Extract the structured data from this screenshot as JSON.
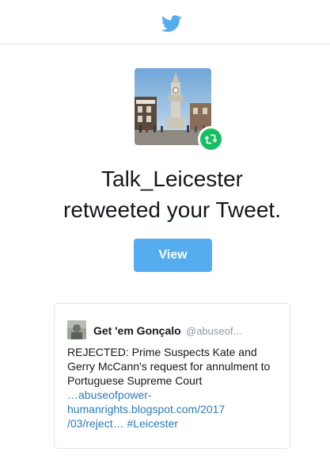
{
  "header": {
    "logo": "twitter-bird-icon"
  },
  "notification": {
    "profile_image": "profile-photo-clock-tower",
    "badge_icon": "retweet-icon",
    "headline_line1": "Talk_Leicester",
    "headline_line2": "retweeted your Tweet.",
    "view_label": "View"
  },
  "tweet": {
    "author_name": "Get 'em Gonçalo",
    "author_handle": "@abuseof...",
    "text_line1": "REJECTED: Prime Suspects Kate and",
    "text_line2": "Gerry McCann's request for annulment to",
    "text_line3": "Portuguese Supreme Court",
    "link_line1": "…abuseofpower-",
    "link_line2": "humanrights.blogspot.com/2017",
    "link_line3": "/03/reject… #Leicester"
  },
  "colors": {
    "brand_blue": "#55acee",
    "retweet_green": "#17bf63",
    "link_blue": "#2b7bb9",
    "border": "#e1e8ed"
  }
}
